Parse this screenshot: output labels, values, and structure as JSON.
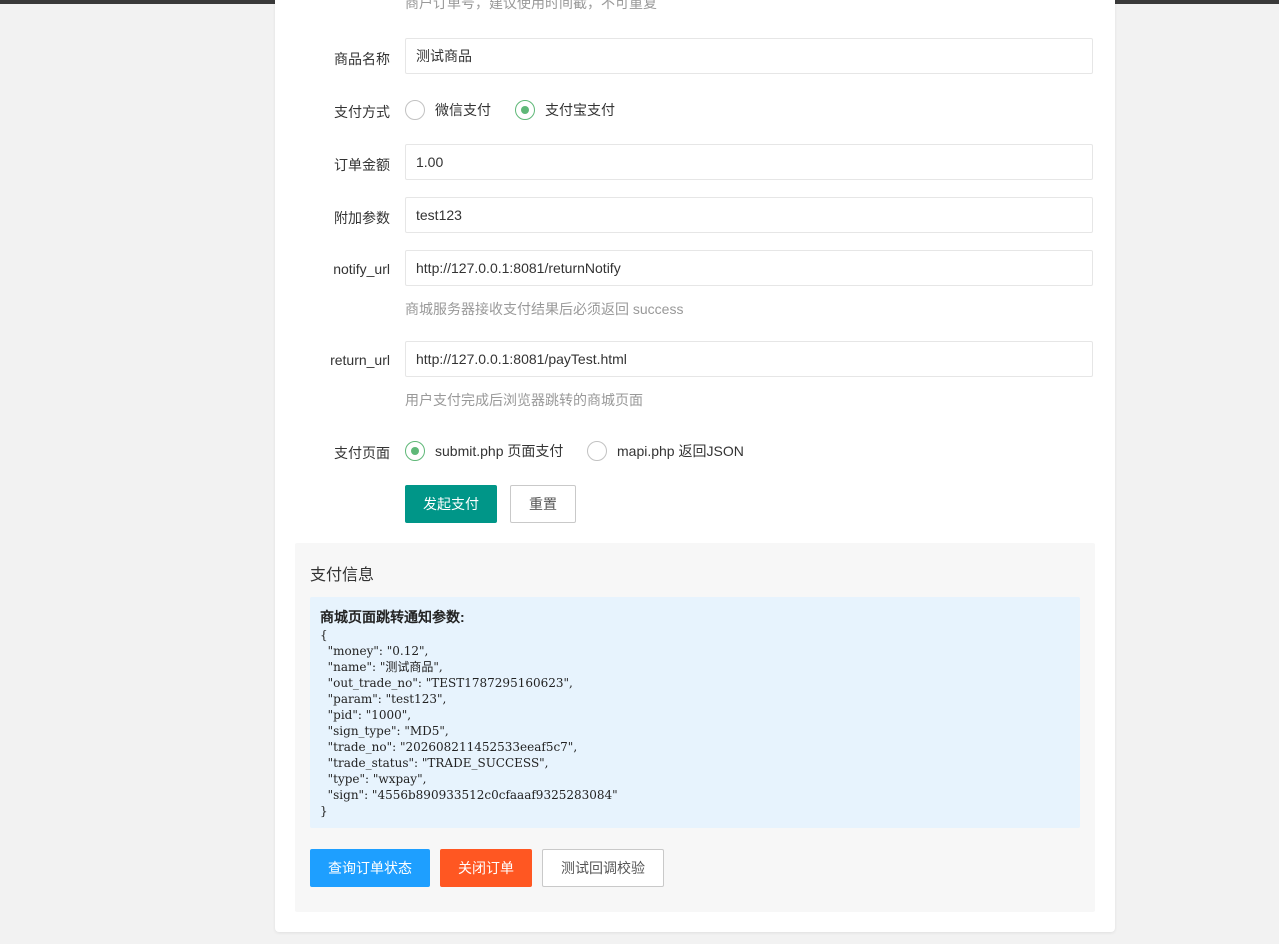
{
  "form": {
    "cut_hint": "商户订单号，建议使用时间截，不可重复",
    "name_label": "商品名称",
    "name_value": "测试商品",
    "paytype_label": "支付方式",
    "paytype_options": [
      "微信支付",
      "支付宝支付"
    ],
    "paytype_selected": "支付宝支付",
    "amount_label": "订单金额",
    "amount_value": "1.00",
    "param_label": "附加参数",
    "param_value": "test123",
    "notify_label": "notify_url",
    "notify_value": "http://127.0.0.1:8081/returnNotify",
    "notify_help": "商城服务器接收支付结果后必须返回 success",
    "return_label": "return_url",
    "return_value": "http://127.0.0.1:8081/payTest.html",
    "return_help": "用户支付完成后浏览器跳转的商城页面",
    "page_label": "支付页面",
    "page_options": [
      "submit.php 页面支付",
      "mapi.php 返回JSON"
    ],
    "page_selected": "submit.php 页面支付",
    "submit_label": "发起支付",
    "reset_label": "重置"
  },
  "info": {
    "title": "支付信息",
    "code_title": "商城页面跳转通知参数:",
    "code_text": "{\n  \"money\": \"0.12\",\n  \"name\": \"测试商品\",\n  \"out_trade_no\": \"TEST1787295160623\",\n  \"param\": \"test123\",\n  \"pid\": \"1000\",\n  \"sign_type\": \"MD5\",\n  \"trade_no\": \"202608211452533eeaf5c7\",\n  \"trade_status\": \"TRADE_SUCCESS\",\n  \"type\": \"wxpay\",\n  \"sign\": \"4556b890933512c0cfaaaf9325283084\"\n}",
    "query_label": "查询订单状态",
    "close_label": "关闭订单",
    "verify_label": "测试回调校验"
  },
  "colors": {
    "primary": "#009688",
    "blue": "#1E9FFF",
    "orange": "#FF5722",
    "radio_checked": "#5FB878",
    "code_bg": "#e7f3fd"
  }
}
